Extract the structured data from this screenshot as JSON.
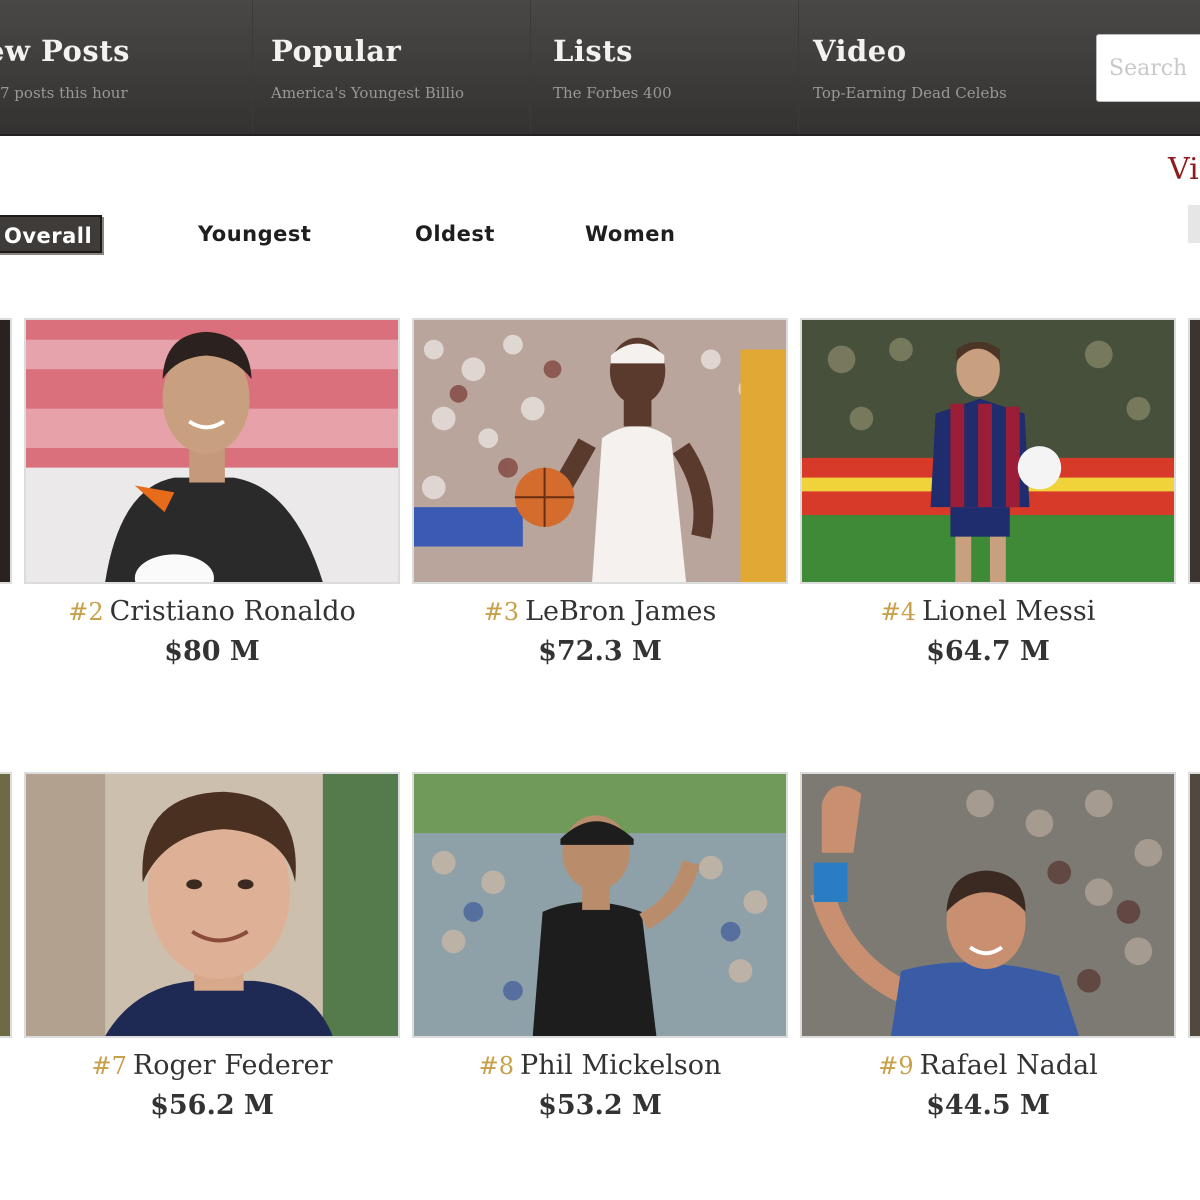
{
  "nav": {
    "items": [
      {
        "title": "ew Posts",
        "subtitle": "7 posts this hour"
      },
      {
        "title": "Popular",
        "subtitle": "America's Youngest Billio"
      },
      {
        "title": "Lists",
        "subtitle": "The Forbes 400"
      },
      {
        "title": "Video",
        "subtitle": "Top-Earning Dead Celebs"
      }
    ],
    "search_placeholder": "Search"
  },
  "corner_link": "Vi",
  "tabs": [
    "Overall",
    "Youngest",
    "Oldest",
    "Women"
  ],
  "active_tab": "Overall",
  "athletes": [
    {
      "rank": "#2",
      "name": "Cristiano Ronaldo",
      "worth": "$80 M"
    },
    {
      "rank": "#3",
      "name": "LeBron James",
      "worth": "$72.3 M"
    },
    {
      "rank": "#4",
      "name": "Lionel Messi",
      "worth": "$64.7 M"
    },
    {
      "rank": "#7",
      "name": "Roger Federer",
      "worth": "$56.2 M"
    },
    {
      "rank": "#8",
      "name": "Phil Mickelson",
      "worth": "$53.2 M"
    },
    {
      "rank": "#9",
      "name": "Rafael Nadal",
      "worth": "$44.5 M"
    }
  ],
  "colors": {
    "nav_bg": "#3e3c3b",
    "rank_gold": "#c8a04a",
    "link_red": "#8e1c1c",
    "active_tab_bg": "#3f3b38"
  }
}
